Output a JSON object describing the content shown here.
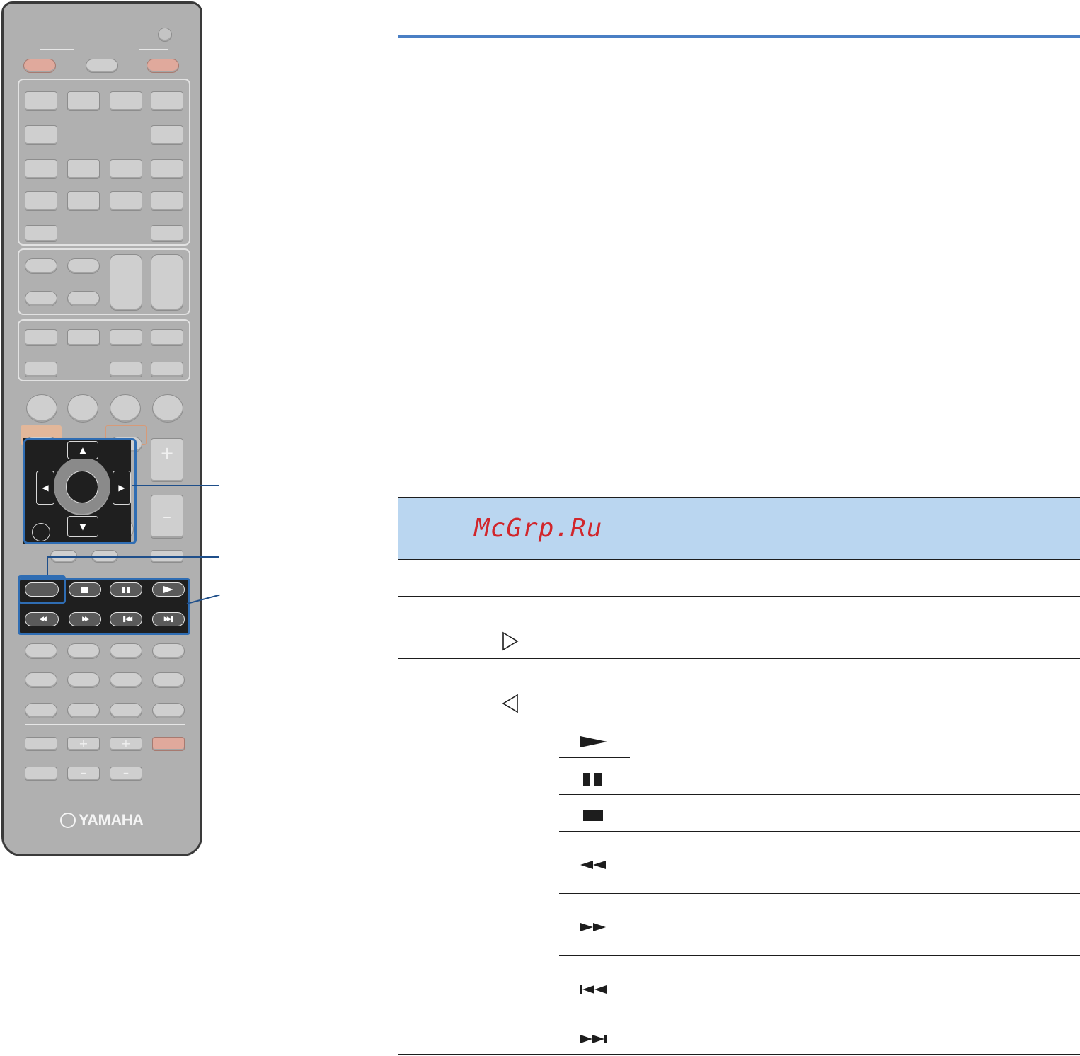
{
  "watermark": {
    "text": "McGrp.Ru"
  },
  "remote": {
    "brand": "YAMAHA",
    "icons": {
      "power": "power-icon",
      "up": "arrow-up-icon",
      "down": "arrow-down-icon",
      "left": "arrow-left-icon",
      "right": "arrow-right-icon",
      "stop": "stop-icon",
      "pause": "pause-icon",
      "play": "play-icon",
      "rewind": "rewind-icon",
      "fast_forward": "fast-forward-icon",
      "skip_back": "skip-back-icon",
      "skip_forward": "skip-forward-icon"
    }
  },
  "table": {
    "symbols": [
      "play-icon",
      "pause-icon",
      "stop-icon",
      "rewind-icon",
      "fast-forward-icon",
      "skip-back-icon",
      "skip-forward-icon"
    ],
    "arrows": [
      "arrow-right-outline-icon",
      "arrow-left-outline-icon"
    ]
  },
  "colors": {
    "accent_blue": "#4a7fc4",
    "highlight_band": "#bad6f0",
    "watermark_red": "#d1262b",
    "callout_blue": "#2f6db3"
  }
}
